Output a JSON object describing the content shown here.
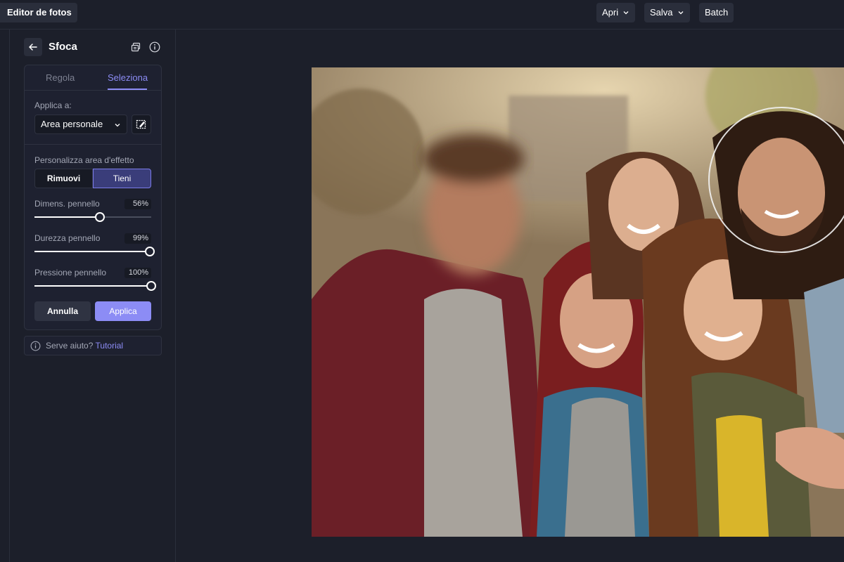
{
  "app": {
    "title": "Editor de fotos"
  },
  "toolbar": {
    "open_label": "Apri",
    "save_label": "Salva",
    "batch_label": "Batch"
  },
  "panel": {
    "title": "Sfoca",
    "tabs": [
      {
        "label": "Regola",
        "active": false
      },
      {
        "label": "Seleziona",
        "active": true
      }
    ],
    "apply_to": {
      "label": "Applica a:",
      "value": "Area personale"
    },
    "effect_area": {
      "label": "Personalizza area d'effetto",
      "remove_label": "Rimuovi",
      "keep_label": "Tieni",
      "selected": "Tieni"
    },
    "sliders": [
      {
        "label": "Dimens. pennello",
        "value_text": "56%",
        "value": 0.56
      },
      {
        "label": "Durezza pennello",
        "value_text": "99%",
        "value": 0.99
      },
      {
        "label": "Pressione pennello",
        "value_text": "100%",
        "value": 1.0
      }
    ],
    "cancel_label": "Annulla",
    "apply_label": "Applica"
  },
  "help": {
    "text": "Serve aiuto?",
    "link": "Tutorial"
  },
  "colors": {
    "accent": "#8c8cf5",
    "background": "#1c1f2a",
    "panel_border": "#2e3240",
    "keep_active_bg": "#3a3d7a"
  },
  "icons": {
    "back": "arrow-left-icon",
    "duplicate": "layers-copy-icon",
    "info": "info-icon",
    "mask": "brush-mask-icon",
    "chevron": "chevron-down-icon"
  }
}
